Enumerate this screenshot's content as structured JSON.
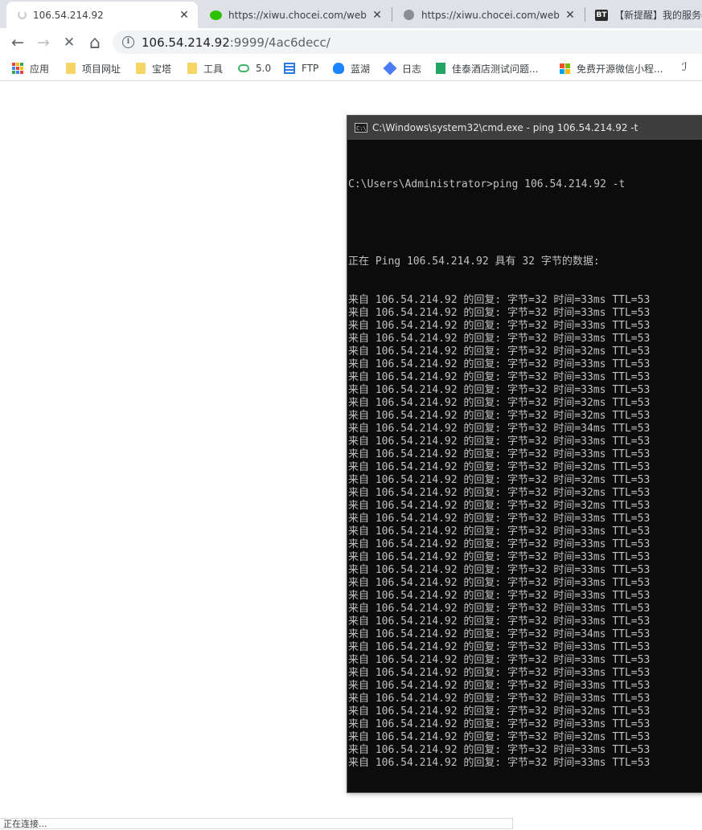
{
  "tabs": [
    {
      "title": "106.54.214.92",
      "icon": "loading-spinner-icon",
      "close": "✕"
    },
    {
      "title": "https://xiwu.chocei.com/web/#/",
      "icon": "wechat-icon",
      "close": "✕"
    },
    {
      "title": "https://xiwu.chocei.com/web/#/",
      "icon": "globe-icon",
      "close": "✕"
    },
    {
      "title": "【新提醒】我的服务器",
      "icon": "bt-icon",
      "icon_text": "BT"
    }
  ],
  "nav": {
    "back": "←",
    "forward": "→",
    "stop": "✕",
    "home": "⌂",
    "info": "i"
  },
  "address": {
    "host": "106.54.214.92",
    "rest": ":9999/4ac6decc/"
  },
  "bookmarks": [
    {
      "label": "应用",
      "icon": "apps-grid-icon"
    },
    {
      "label": "项目网址",
      "icon": "folder-icon"
    },
    {
      "label": "宝塔",
      "icon": "folder-icon"
    },
    {
      "label": "工具",
      "icon": "folder-icon"
    },
    {
      "label": "5.0",
      "icon": "cloud-icon"
    },
    {
      "label": "FTP",
      "icon": "ftp-icon"
    },
    {
      "label": "蓝湖",
      "icon": "lanhu-icon"
    },
    {
      "label": "日志",
      "icon": "log-icon"
    },
    {
      "label": "佳泰酒店测试问题...",
      "icon": "sheet-icon"
    },
    {
      "label": "免费开源微信小程...",
      "icon": "microsoft-icon"
    }
  ],
  "bookmarks_more": "ℐ",
  "colors": {
    "accent": "#1a73e8",
    "terminal_bg": "#0c0c0c",
    "terminal_fg": "#c0c0c0"
  },
  "cmd": {
    "icon_text": "C:\\",
    "title": "C:\\Windows\\system32\\cmd.exe - ping  106.54.214.92 -t",
    "prompt": "C:\\Users\\Administrator>ping 106.54.214.92 -t",
    "header": "正在 Ping 106.54.214.92 具有 32 字节的数据:",
    "replies": [
      "来自 106.54.214.92 的回复: 字节=32 时间=33ms TTL=53",
      "来自 106.54.214.92 的回复: 字节=32 时间=33ms TTL=53",
      "来自 106.54.214.92 的回复: 字节=32 时间=33ms TTL=53",
      "来自 106.54.214.92 的回复: 字节=32 时间=33ms TTL=53",
      "来自 106.54.214.92 的回复: 字节=32 时间=32ms TTL=53",
      "来自 106.54.214.92 的回复: 字节=32 时间=33ms TTL=53",
      "来自 106.54.214.92 的回复: 字节=32 时间=33ms TTL=53",
      "来自 106.54.214.92 的回复: 字节=32 时间=33ms TTL=53",
      "来自 106.54.214.92 的回复: 字节=32 时间=32ms TTL=53",
      "来自 106.54.214.92 的回复: 字节=32 时间=32ms TTL=53",
      "来自 106.54.214.92 的回复: 字节=32 时间=34ms TTL=53",
      "来自 106.54.214.92 的回复: 字节=32 时间=33ms TTL=53",
      "来自 106.54.214.92 的回复: 字节=32 时间=33ms TTL=53",
      "来自 106.54.214.92 的回复: 字节=32 时间=32ms TTL=53",
      "来自 106.54.214.92 的回复: 字节=32 时间=32ms TTL=53",
      "来自 106.54.214.92 的回复: 字节=32 时间=32ms TTL=53",
      "来自 106.54.214.92 的回复: 字节=32 时间=32ms TTL=53",
      "来自 106.54.214.92 的回复: 字节=32 时间=33ms TTL=53",
      "来自 106.54.214.92 的回复: 字节=32 时间=33ms TTL=53",
      "来自 106.54.214.92 的回复: 字节=32 时间=33ms TTL=53",
      "来自 106.54.214.92 的回复: 字节=32 时间=33ms TTL=53",
      "来自 106.54.214.92 的回复: 字节=32 时间=33ms TTL=53",
      "来自 106.54.214.92 的回复: 字节=32 时间=33ms TTL=53",
      "来自 106.54.214.92 的回复: 字节=32 时间=33ms TTL=53",
      "来自 106.54.214.92 的回复: 字节=32 时间=33ms TTL=53",
      "来自 106.54.214.92 的回复: 字节=32 时间=33ms TTL=53",
      "来自 106.54.214.92 的回复: 字节=32 时间=34ms TTL=53",
      "来自 106.54.214.92 的回复: 字节=32 时间=33ms TTL=53",
      "来自 106.54.214.92 的回复: 字节=32 时间=33ms TTL=53",
      "来自 106.54.214.92 的回复: 字节=32 时间=33ms TTL=53",
      "来自 106.54.214.92 的回复: 字节=32 时间=33ms TTL=53",
      "来自 106.54.214.92 的回复: 字节=32 时间=33ms TTL=53",
      "来自 106.54.214.92 的回复: 字节=32 时间=32ms TTL=53",
      "来自 106.54.214.92 的回复: 字节=32 时间=33ms TTL=53",
      "来自 106.54.214.92 的回复: 字节=32 时间=32ms TTL=53",
      "来自 106.54.214.92 的回复: 字节=32 时间=33ms TTL=53",
      "来自 106.54.214.92 的回复: 字节=32 时间=33ms TTL=53"
    ]
  },
  "status": "正在连接..."
}
